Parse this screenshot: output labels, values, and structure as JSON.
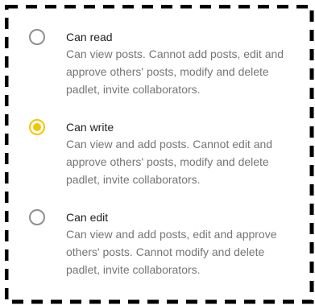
{
  "permissions": {
    "options": [
      {
        "label": "Can read",
        "description": "Can view posts. Cannot add posts, edit and approve others' posts, modify and delete padlet, invite collaborators.",
        "selected": false
      },
      {
        "label": "Can write",
        "description": "Can view and add posts. Cannot edit and approve others' posts, modify and delete padlet, invite collaborators.",
        "selected": true
      },
      {
        "label": "Can edit",
        "description": "Can view and add posts, edit and approve others' posts. Cannot modify and delete padlet, invite collaborators.",
        "selected": false
      }
    ]
  },
  "colors": {
    "accent": "#f5c400",
    "radio_border": "#8f8f8f",
    "title_text": "#222222",
    "description_text": "#757575",
    "frame": "#000000"
  }
}
